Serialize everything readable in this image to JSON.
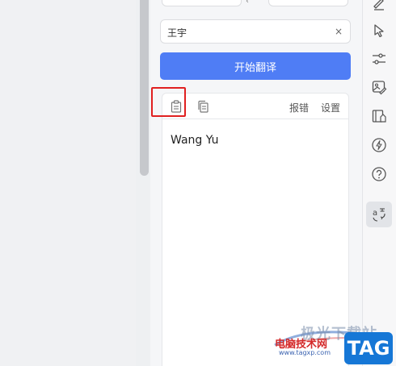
{
  "input": {
    "value": "王宇",
    "clear_glyph": "×"
  },
  "translate_button": {
    "label": "开始翻译"
  },
  "result": {
    "toolbar": {
      "report_label": "报错",
      "settings_label": "设置"
    },
    "text": "Wang Yu"
  },
  "lang_swap_glyph": "‹",
  "right_bar": {
    "icons": [
      "edit-icon",
      "pointer-icon",
      "sliders-icon",
      "image-edit-icon",
      "book-icon",
      "lightning-icon",
      "help-icon",
      "translate-icon"
    ]
  },
  "watermark": {
    "site_name": "极光下载站",
    "red_text": "电脑技术网",
    "url": "www.tagxp.com",
    "tag": "TAG"
  },
  "colors": {
    "accent": "#4f7df5",
    "highlight": "#e02020",
    "tag_blue": "#1677d6"
  }
}
